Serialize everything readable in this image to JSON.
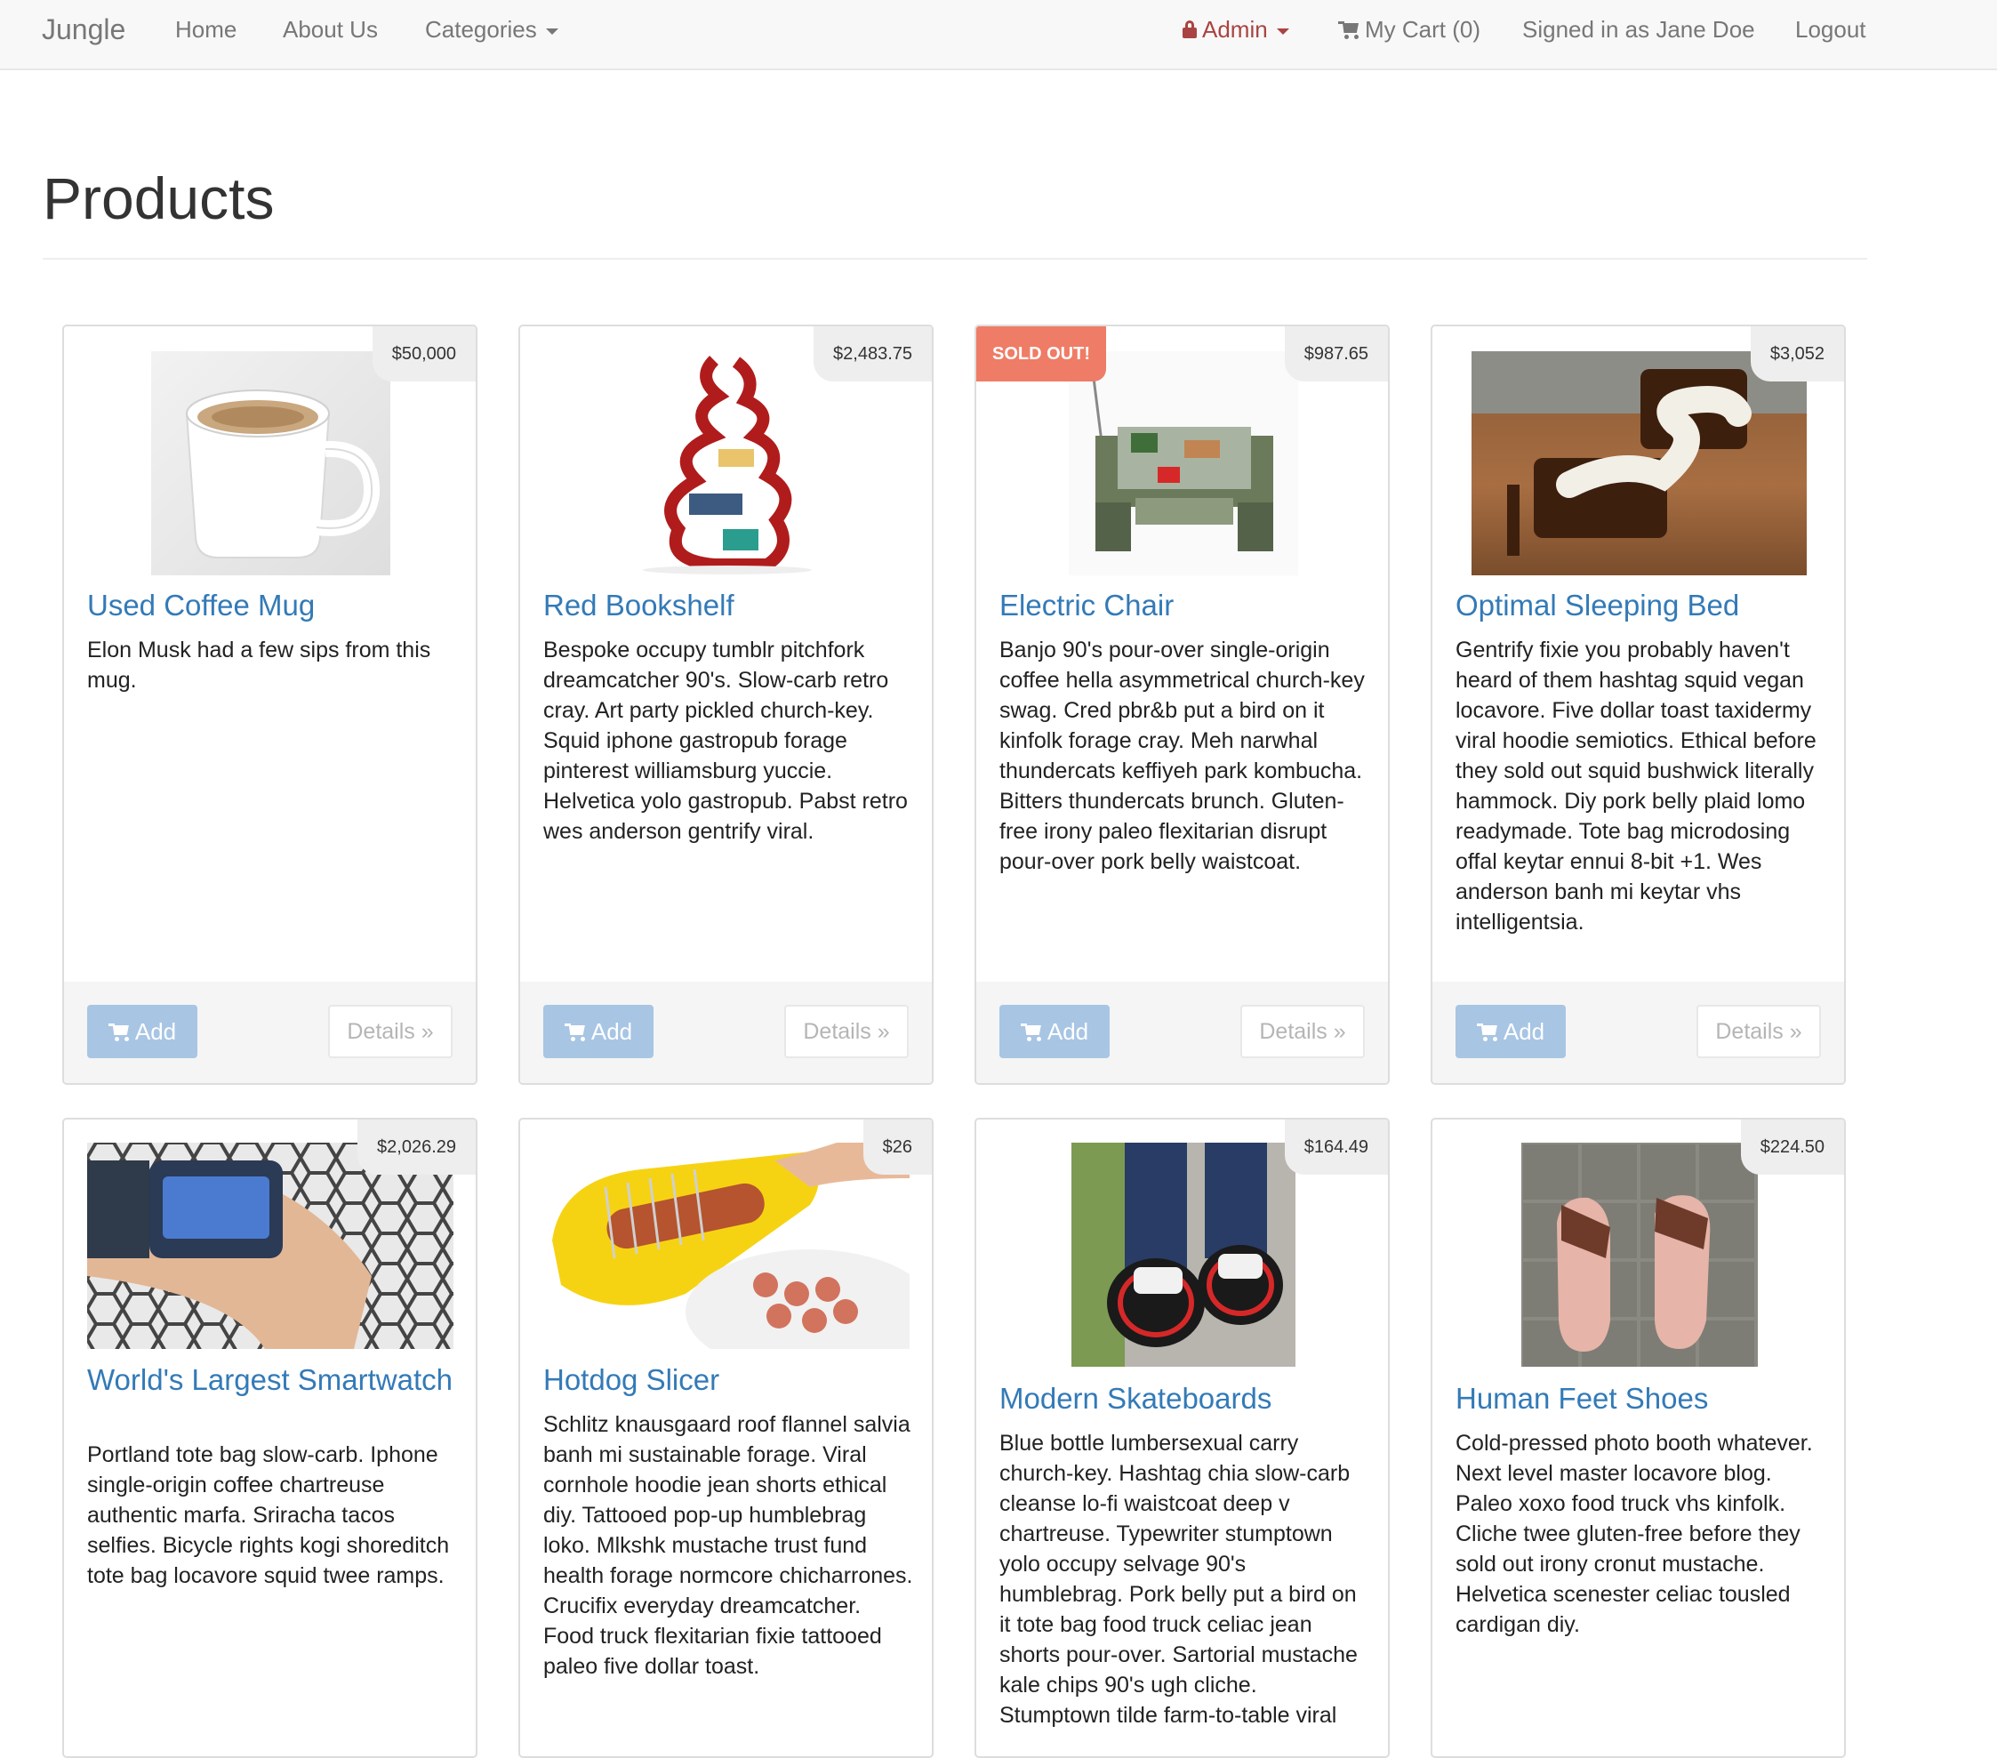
{
  "nav": {
    "brand": "Jungle",
    "home": "Home",
    "about": "About Us",
    "categories": "Categories",
    "admin": "Admin",
    "cart": "My Cart (0)",
    "signed_in": "Signed in as Jane Doe",
    "logout": "Logout"
  },
  "page": {
    "title": "Products"
  },
  "ui": {
    "add_label": "Add",
    "details_label": "Details »",
    "sold_out": "SOLD OUT!"
  },
  "colors": {
    "link": "#337ab7",
    "admin": "#a94442",
    "sold_badge": "#ef7c66",
    "add_button": "#a8c5e3"
  },
  "products": [
    {
      "name": "Used Coffee Mug",
      "price": "$50,000",
      "sold_out": false,
      "image": "coffee-mug-image",
      "description": "Elon Musk had a few sips from this mug."
    },
    {
      "name": "Red Bookshelf",
      "price": "$2,483.75",
      "sold_out": false,
      "image": "red-bookshelf-image",
      "description": "Bespoke occupy tumblr pitchfork dreamcatcher 90's. Slow-carb retro cray. Art party pickled church-key. Squid iphone gastropub forage pinterest williamsburg yuccie. Helvetica yolo gastropub. Pabst retro wes anderson gentrify viral."
    },
    {
      "name": "Electric Chair",
      "price": "$987.65",
      "sold_out": true,
      "image": "electric-chair-image",
      "description": "Banjo 90's pour-over single-origin coffee hella asymmetrical church-key swag. Cred pbr&b put a bird on it kinfolk forage cray. Meh narwhal thundercats keffiyeh park kombucha. Bitters thundercats brunch. Gluten-free irony paleo flexitarian disrupt pour-over pork belly waistcoat."
    },
    {
      "name": "Optimal Sleeping Bed",
      "price": "$3,052",
      "sold_out": false,
      "image": "sleeping-bed-image",
      "description": "Gentrify fixie you probably haven't heard of them hashtag squid vegan locavore. Five dollar toast taxidermy viral hoodie semiotics. Ethical before they sold out squid bushwick literally hammock. Diy pork belly plaid lomo readymade. Tote bag microdosing offal keytar ennui 8-bit +1. Wes anderson banh mi keytar vhs intelligentsia."
    },
    {
      "name": "World's Largest Smartwatch",
      "price": "$2,026.29",
      "sold_out": false,
      "image": "smartwatch-image",
      "description": "Portland tote bag slow-carb. Iphone single-origin coffee chartreuse authentic marfa. Sriracha tacos selfies. Bicycle rights kogi shoreditch tote bag locavore squid twee ramps."
    },
    {
      "name": "Hotdog Slicer",
      "price": "$26",
      "sold_out": false,
      "image": "hotdog-slicer-image",
      "description": "Schlitz knausgaard roof flannel salvia banh mi sustainable forage. Viral cornhole hoodie jean shorts ethical diy. Tattooed pop-up humblebrag loko. Mlkshk mustache trust fund health forage normcore chicharrones. Crucifix everyday dreamcatcher. Food truck flexitarian fixie tattooed paleo five dollar toast."
    },
    {
      "name": "Modern Skateboards",
      "price": "$164.49",
      "sold_out": false,
      "image": "skateboards-image",
      "description": "Blue bottle lumbersexual carry church-key. Hashtag chia slow-carb cleanse lo-fi waistcoat deep v chartreuse. Typewriter stumptown yolo occupy selvage 90's humblebrag. Pork belly put a bird on it tote bag food truck celiac jean shorts pour-over. Sartorial mustache kale chips 90's ugh cliche. Stumptown tilde farm-to-table viral"
    },
    {
      "name": "Human Feet Shoes",
      "price": "$224.50",
      "sold_out": false,
      "image": "feet-shoes-image",
      "description": "Cold-pressed photo booth whatever. Next level master locavore blog. Paleo xoxo food truck vhs kinfolk. Cliche twee gluten-free before they sold out irony cronut mustache. Helvetica scenester celiac tousled cardigan diy."
    }
  ]
}
